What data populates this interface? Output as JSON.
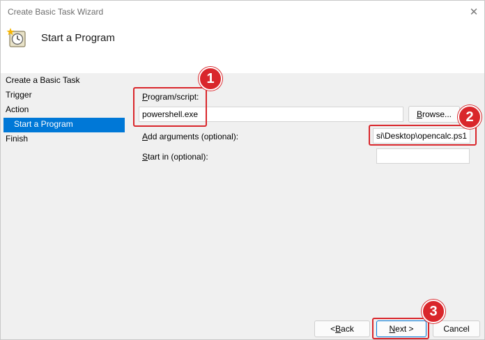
{
  "window": {
    "title": "Create Basic Task Wizard",
    "close_symbol": "✕"
  },
  "header": {
    "heading": "Start a Program",
    "icon": "task-clock-icon"
  },
  "sidebar": {
    "items": [
      {
        "label": "Create a Basic Task"
      },
      {
        "label": "Trigger"
      },
      {
        "label": "Action"
      },
      {
        "label": "Start a Program"
      },
      {
        "label": "Finish"
      }
    ]
  },
  "form": {
    "program_label_first": "P",
    "program_label_rest": "rogram/script:",
    "program_value": "powershell.exe",
    "browse_label_first": "B",
    "browse_label_rest": "rowse...",
    "arguments_label_first": "A",
    "arguments_label_rest": "dd arguments (optional):",
    "arguments_value": "si\\Desktop\\opencalc.ps1",
    "startin_label_first": "S",
    "startin_label_rest": "tart in (optional):",
    "startin_value": ""
  },
  "buttons": {
    "back_first": "< ",
    "back_u": "B",
    "back_rest": "ack",
    "next_first": "",
    "next_u": "N",
    "next_rest": "ext >",
    "cancel": "Cancel"
  },
  "annotations": {
    "badge1": "1",
    "badge2": "2",
    "badge3": "3"
  },
  "colors": {
    "accent": "#0078d7",
    "annotation_red": "#d9262b"
  }
}
